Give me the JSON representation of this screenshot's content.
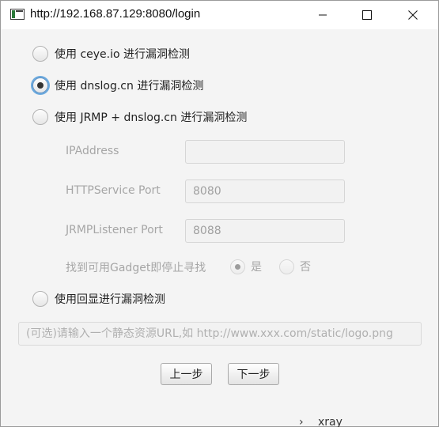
{
  "window": {
    "title": "http://192.168.87.129:8080/login"
  },
  "options": [
    {
      "label": "使用 ceye.io 进行漏洞检测",
      "checked": false
    },
    {
      "label": "使用 dnslog.cn 进行漏洞检测",
      "checked": true
    },
    {
      "label": "使用 JRMP + dnslog.cn 进行漏洞检测",
      "checked": false
    },
    {
      "label": "使用回显进行漏洞检测",
      "checked": false
    }
  ],
  "jrmp": {
    "ip_label": "IPAddress",
    "ip_value": "",
    "http_label": "HTTPService Port",
    "http_value": "8080",
    "jrmp_label": "JRMPListener Port",
    "jrmp_value": "8088",
    "gadget_label": "找到可用Gadget即停止寻找",
    "yes_label": "是",
    "no_label": "否"
  },
  "static_url": {
    "placeholder": "(可选)请输入一个静态资源URL,如 http://www.xxx.com/static/logo.png"
  },
  "buttons": {
    "prev": "上一步",
    "next": "下一步"
  },
  "background": {
    "glyph": "xray"
  }
}
